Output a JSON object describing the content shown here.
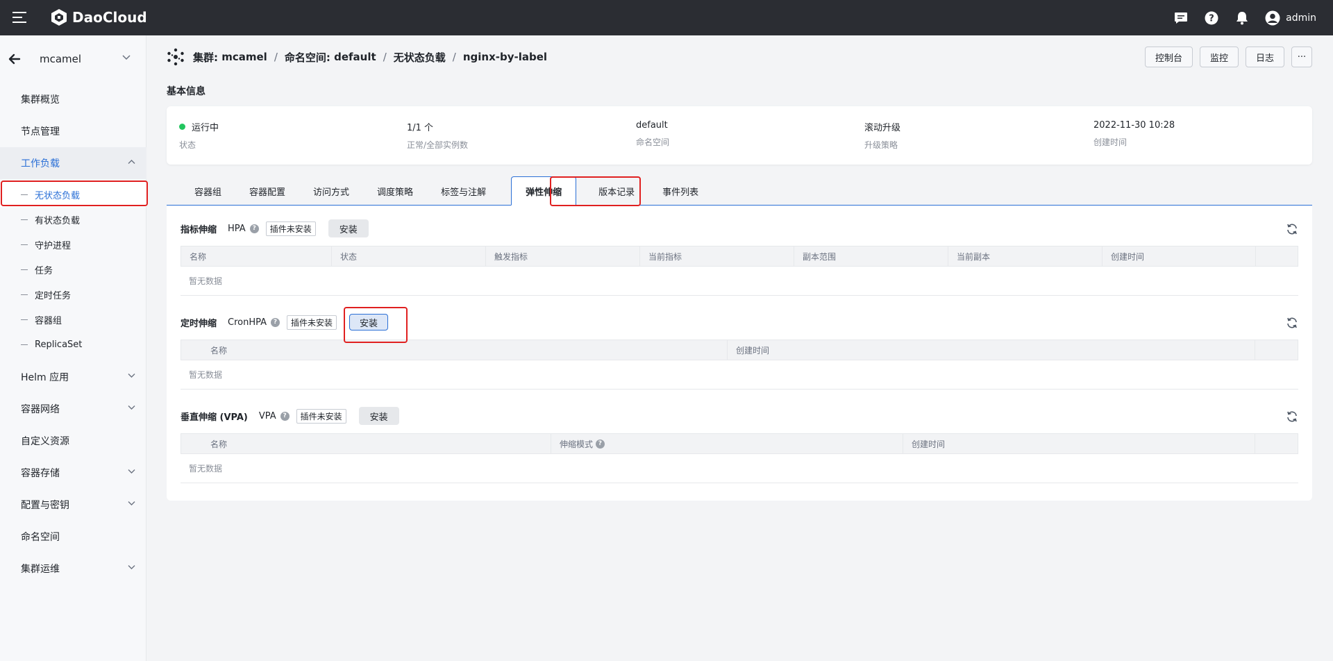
{
  "topbar": {
    "brand": "DaoCloud",
    "user": "admin"
  },
  "sidebar": {
    "cluster": "mcamel",
    "items": [
      {
        "label": "集群概览"
      },
      {
        "label": "节点管理"
      },
      {
        "label": "工作负载"
      },
      {
        "label": "Helm 应用"
      },
      {
        "label": "容器网络"
      },
      {
        "label": "自定义资源"
      },
      {
        "label": "容器存储"
      },
      {
        "label": "配置与密钥"
      },
      {
        "label": "命名空间"
      },
      {
        "label": "集群运维"
      }
    ],
    "workload_children": [
      {
        "label": "无状态负载"
      },
      {
        "label": "有状态负载"
      },
      {
        "label": "守护进程"
      },
      {
        "label": "任务"
      },
      {
        "label": "定时任务"
      },
      {
        "label": "容器组"
      },
      {
        "label": "ReplicaSet"
      }
    ]
  },
  "breadcrumb": {
    "cluster_label": "集群:",
    "cluster": "mcamel",
    "ns_label": "命名空间:",
    "namespace": "default",
    "section": "无状态负载",
    "name": "nginx-by-label"
  },
  "header_buttons": {
    "console": "控制台",
    "monitor": "监控",
    "logs": "日志",
    "more": "···"
  },
  "basic_info": {
    "title": "基本信息",
    "cols": [
      {
        "value": "运行中",
        "label": "状态"
      },
      {
        "value": "1/1 个",
        "label": "正常/全部实例数"
      },
      {
        "value": "default",
        "label": "命名空间"
      },
      {
        "value": "滚动升级",
        "label": "升级策略"
      },
      {
        "value": "2022-11-30 10:28",
        "label": "创建时间"
      }
    ]
  },
  "tabs": [
    "容器组",
    "容器配置",
    "访问方式",
    "调度策略",
    "标签与注解",
    "弹性伸缩",
    "版本记录",
    "事件列表"
  ],
  "scaling": {
    "hpa": {
      "title": "指标伸缩",
      "kind": "HPA",
      "tag": "插件未安装",
      "install": "安装",
      "columns": [
        "名称",
        "状态",
        "触发指标",
        "当前指标",
        "副本范围",
        "当前副本",
        "创建时间",
        ""
      ],
      "empty": "暂无数据"
    },
    "cron": {
      "title": "定时伸缩",
      "kind": "CronHPA",
      "tag": "插件未安装",
      "install": "安装",
      "columns": [
        "名称",
        "创建时间",
        ""
      ],
      "empty": "暂无数据"
    },
    "vpa": {
      "title": "垂直伸缩 (VPA)",
      "kind": "VPA",
      "tag": "插件未安装",
      "install": "安装",
      "columns": [
        "名称",
        "伸缩模式",
        "创建时间",
        ""
      ],
      "empty": "暂无数据"
    }
  },
  "colors": {
    "accent": "#2a6fd6",
    "topbar": "#2b2d33",
    "running": "#22c55e",
    "highlight": "#e02020"
  }
}
